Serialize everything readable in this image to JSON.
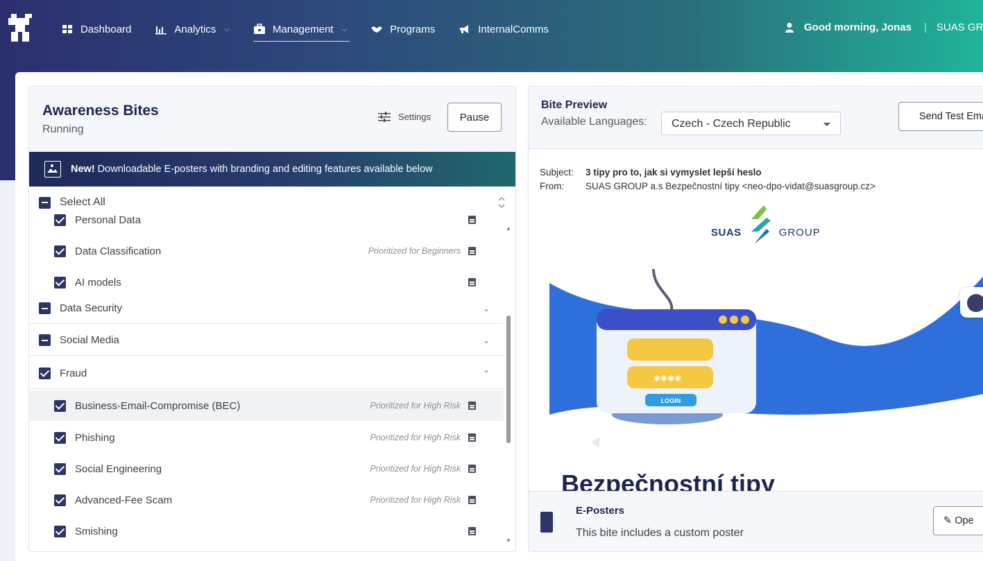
{
  "nav": {
    "items": [
      {
        "label": "Dashboard",
        "icon": "grid-icon",
        "has_dropdown": false
      },
      {
        "label": "Analytics",
        "icon": "bar-chart-icon",
        "has_dropdown": true
      },
      {
        "label": "Management",
        "icon": "toolbox-icon",
        "has_dropdown": true,
        "active": true
      },
      {
        "label": "Programs",
        "icon": "handshake-icon",
        "has_dropdown": false
      },
      {
        "label": "InternalComms",
        "icon": "megaphone-icon",
        "has_dropdown": false
      }
    ],
    "greeting": "Good morning, Jonas",
    "separator": "|",
    "org": "SUAS GRO"
  },
  "left_panel": {
    "title": "Awareness Bites",
    "status": "Running",
    "settings_label": "Settings",
    "pause_label": "Pause",
    "banner": {
      "new_label": "New!",
      "text": " Downloadable E-posters with branding and editing features available below"
    },
    "select_all": "Select All",
    "rows": [
      {
        "label": "Personal Data",
        "priority": "",
        "type": "item"
      },
      {
        "label": "Data Classification",
        "priority": "Prioritized for Beginners",
        "type": "item"
      },
      {
        "label": "AI models",
        "priority": "",
        "type": "item"
      },
      {
        "label": "Data Security",
        "type": "group",
        "state": "partial",
        "expanded": false
      },
      {
        "label": "Social Media",
        "type": "group",
        "state": "partial",
        "expanded": false
      },
      {
        "label": "Fraud",
        "type": "group",
        "state": "checked",
        "expanded": true
      },
      {
        "label": "Business-Email-Compromise (BEC)",
        "priority": "Prioritized for High Risk",
        "type": "item"
      },
      {
        "label": "Phishing",
        "priority": "Prioritized for High Risk",
        "type": "item"
      },
      {
        "label": "Social Engineering",
        "priority": "Prioritized for High Risk",
        "type": "item"
      },
      {
        "label": "Advanced-Fee Scam",
        "priority": "Prioritized for High Risk",
        "type": "item"
      },
      {
        "label": "Smishing",
        "priority": "",
        "type": "item"
      }
    ]
  },
  "right_panel": {
    "title": "Bite Preview",
    "languages_label": "Available Languages:",
    "language_selected": "Czech - Czech Republic",
    "send_test_label": "Send Test Ema",
    "subject_key": "Subject:",
    "subject_value": "3 tipy pro to, jak si vymyslet lepší heslo",
    "from_key": "From:",
    "from_value": "SUAS GROUP a.s Bezpečnostní tipy <neo-dpo-vidat@suasgroup.cz>",
    "brand_name_1": "SUAS",
    "brand_name_2": "GROUP",
    "hero_button": "LOGIN",
    "hero_title": "Bezpečnostní tipy",
    "eposters_title": "E-Posters",
    "eposters_desc": "This bite includes a custom poster",
    "open_label": "Ope"
  },
  "colors": {
    "navy": "#2d3566",
    "teal": "#1fb49a",
    "hero_blue": "#2f6fdc"
  }
}
